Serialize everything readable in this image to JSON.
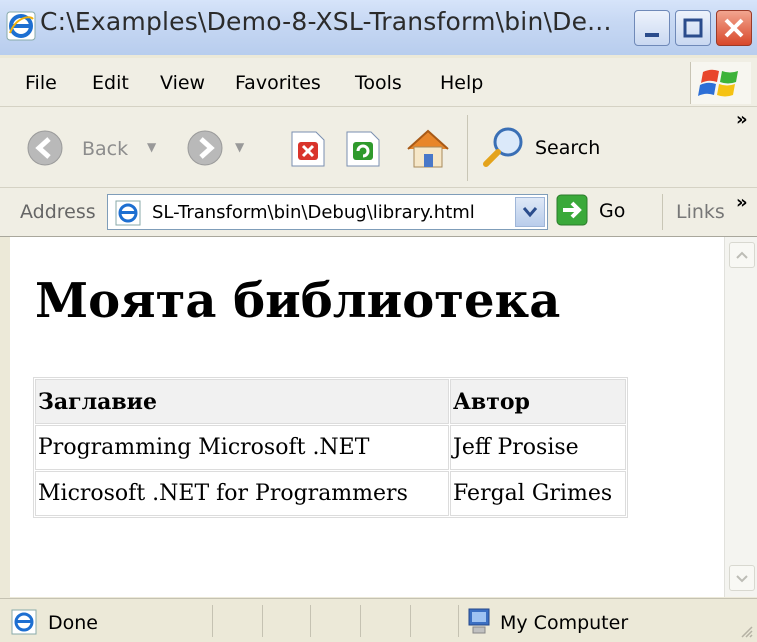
{
  "window": {
    "title": "C:\\Examples\\Demo-8-XSL-Transform\\bin\\De..."
  },
  "menu": {
    "items": [
      "File",
      "Edit",
      "View",
      "Favorites",
      "Tools",
      "Help"
    ]
  },
  "toolbar": {
    "back_label": "Back",
    "search_label": "Search",
    "more": "»"
  },
  "address": {
    "label": "Address",
    "value": "SL-Transform\\bin\\Debug\\library.html",
    "go_label": "Go",
    "links_label": "Links",
    "more": "»"
  },
  "page": {
    "heading": "Моята библиотека",
    "table": {
      "headers": [
        "Заглавие",
        "Автор"
      ],
      "rows": [
        [
          "Programming Microsoft .NET",
          "Jeff Prosise"
        ],
        [
          "Microsoft .NET for Programmers",
          "Fergal Grimes"
        ]
      ]
    }
  },
  "status": {
    "left": "Done",
    "zone": "My Computer"
  },
  "colors": {
    "titlebar": "#c7d8f3",
    "chrome": "#ece9d8",
    "close_button": "#d8482b"
  }
}
